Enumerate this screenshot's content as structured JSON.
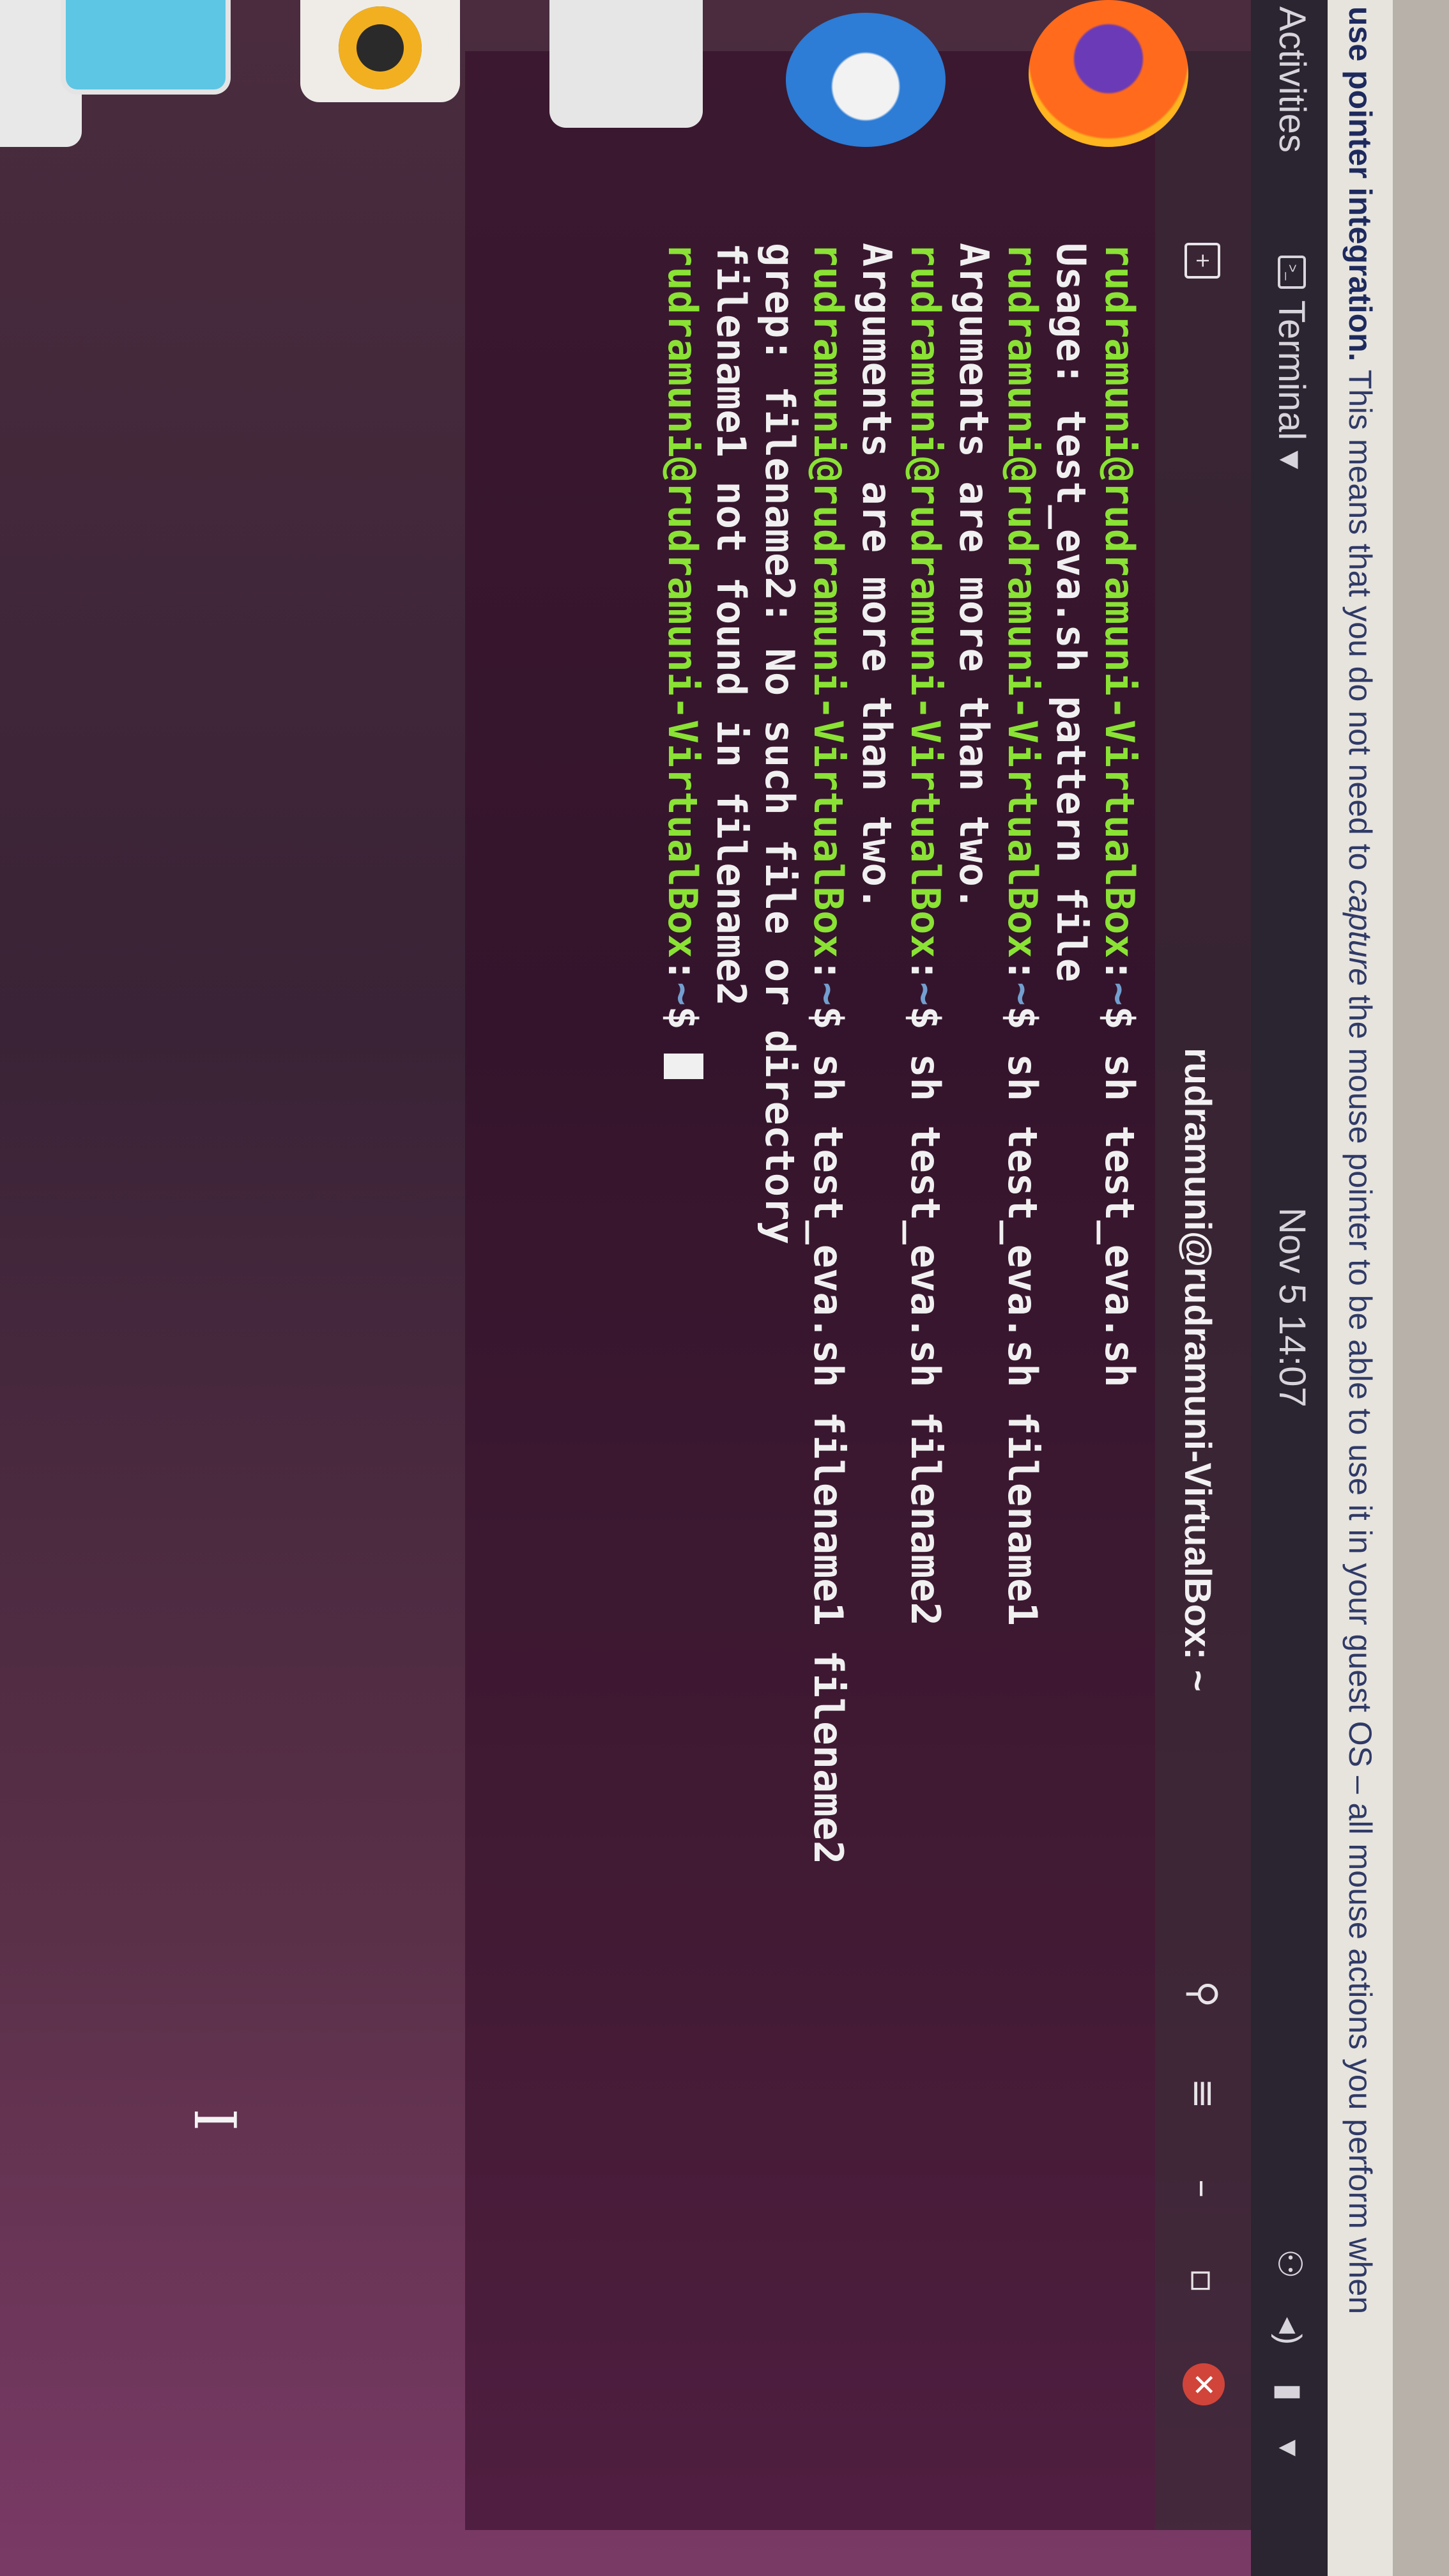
{
  "vbox_notice": {
    "lead": "use pointer integration.",
    "text": " This means that you do not need to ",
    "emph": "capture",
    "text2": " the mouse pointer to be able to use it in your guest OS – all mouse actions you perform when"
  },
  "top_bar": {
    "activities": "Activities",
    "app_menu": "Terminal ▾",
    "clock": "Nov 5  14:07",
    "tray_icons": [
      "network-icon",
      "volume-icon",
      "battery-icon",
      "power-menu-icon"
    ]
  },
  "terminal": {
    "title": "rudramuni@rudramuni-VirtualBox: ~",
    "prompt_user": "rudramuni@rudramuni-VirtualBox",
    "prompt_path": "~",
    "lines": [
      {
        "kind": "prompt",
        "cmd": "sh test_eva.sh"
      },
      {
        "kind": "out",
        "text": "Usage: test_eva.sh pattern file"
      },
      {
        "kind": "prompt",
        "cmd": "sh test_eva.sh filename1"
      },
      {
        "kind": "out",
        "text": "Arguments are more than two."
      },
      {
        "kind": "prompt",
        "cmd": "sh test_eva.sh filename2"
      },
      {
        "kind": "out",
        "text": "Arguments are more than two."
      },
      {
        "kind": "prompt",
        "cmd": "sh test_eva.sh filename1 filename2"
      },
      {
        "kind": "out",
        "text": "grep: filename2: No such file or directory"
      },
      {
        "kind": "out",
        "text": "filename1 not found in filename2"
      },
      {
        "kind": "prompt",
        "cmd": ""
      }
    ],
    "controls": {
      "search_icon": "search-icon",
      "menu_icon": "hamburger-menu-icon",
      "minimize": "–",
      "maximize": "▫",
      "close": "✕"
    }
  },
  "colors": {
    "prompt_user": "#8ae234",
    "prompt_path": "#729fcf",
    "close_button": "#d0443a"
  }
}
